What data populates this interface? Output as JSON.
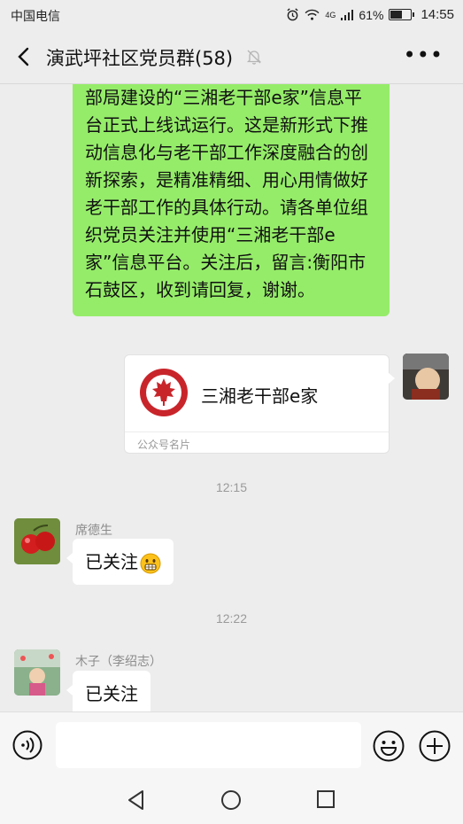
{
  "status_bar": {
    "carrier": "中国电信",
    "network": "4G",
    "battery_percent": "61%",
    "battery_level": 0.61,
    "time": "14:55"
  },
  "header": {
    "title": "演武坪社区党员群(58)"
  },
  "messages": {
    "self_text": "部局建设的“三湘老干部e家”信息平台正式上线试运行。这是新形式下推动信息化与老干部工作深度融合的创新探索，是精准精细、用心用情做好老干部工作的具体行动。请各单位组织党员关注并使用“三湘老干部e家”信息平台。关注后，留言:衡阳市石鼓区，收到请回复，谢谢。",
    "card": {
      "name": "三湘老干部e家",
      "type": "公众号名片"
    },
    "time_1": "12:15",
    "msg_1": {
      "sender": "席德生",
      "text": "已关注"
    },
    "time_2": "12:22",
    "msg_2": {
      "sender": "木子（李绍志）",
      "text": "已关注"
    }
  },
  "icons": {
    "back": "back-arrow-icon",
    "mute": "muted-bell-icon",
    "more": "more-dots-icon",
    "voice": "voice-icon",
    "emoji": "emoji-icon",
    "plus": "plus-icon",
    "nav": [
      "nav-back-icon",
      "nav-home-icon",
      "nav-recents-icon"
    ]
  },
  "colors": {
    "self_bubble": "#95ec69",
    "other_bubble": "#ffffff",
    "background": "#ededed",
    "card_logo": "#c8252b"
  }
}
